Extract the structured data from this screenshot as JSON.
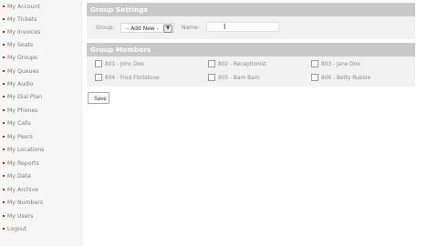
{
  "sidebar": {
    "items": [
      {
        "label": "My Account"
      },
      {
        "label": "My Tickets"
      },
      {
        "label": "My Invoices"
      },
      {
        "label": "My Seats"
      },
      {
        "label": "My Groups"
      },
      {
        "label": "My Queues"
      },
      {
        "label": "My Audio"
      },
      {
        "label": "My Dial Plan"
      },
      {
        "label": "My Phones"
      },
      {
        "label": "My Calls"
      },
      {
        "label": "My Peers"
      },
      {
        "label": "My Locations"
      },
      {
        "label": "My Reports"
      },
      {
        "label": "My Data"
      },
      {
        "label": "My Archive"
      },
      {
        "label": "My Numbers"
      },
      {
        "label": "My Users"
      },
      {
        "label": "Logout"
      }
    ]
  },
  "settings": {
    "header": "Group Settings",
    "group_label": "Group:",
    "group_value": "- Add New -",
    "name_label": "Name:",
    "name_value": ""
  },
  "members": {
    "header": "Group Members",
    "items": [
      {
        "label": "801 - John Doe"
      },
      {
        "label": "802 - Receptionist"
      },
      {
        "label": "803 - Jane Doe"
      },
      {
        "label": "804 - Fred Flintstone"
      },
      {
        "label": "805 - Barn Barn"
      },
      {
        "label": "806 - Betty Rubble"
      }
    ]
  },
  "actions": {
    "save_label": "Save"
  },
  "colors": {
    "header_bg": "#c9c9c9",
    "panel_bg": "#f2f2f2",
    "bullet": "#8b2a1a"
  }
}
